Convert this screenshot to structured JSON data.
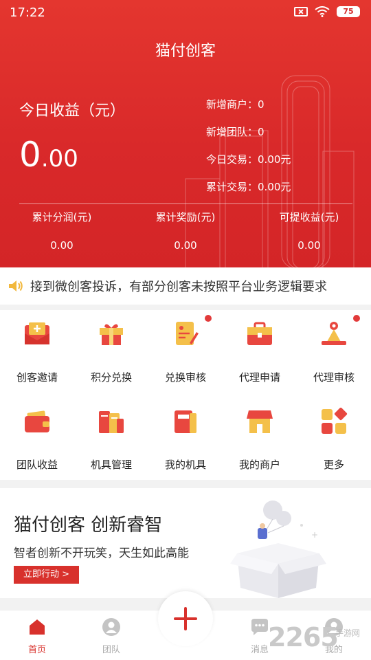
{
  "status_bar": {
    "time": "17:22",
    "battery": "75"
  },
  "header": {
    "title": "猫付创客",
    "earnings_label": "今日收益（元）",
    "earnings_int": "0",
    "earnings_dec": ".00",
    "stats": [
      {
        "label": "新增商户：",
        "value": "0"
      },
      {
        "label": "新增团队：",
        "value": "0"
      },
      {
        "label": "今日交易：",
        "value": "0.00元"
      },
      {
        "label": "累计交易：",
        "value": "0.00元"
      }
    ],
    "totals": [
      {
        "label": "累计分润(元)",
        "value": "0.00"
      },
      {
        "label": "累计奖励(元)",
        "value": "0.00"
      },
      {
        "label": "可提收益(元)",
        "value": "0.00"
      }
    ]
  },
  "notice": {
    "text": "接到微创客投诉，有部分创客未按照平台业务逻辑要求"
  },
  "menu": {
    "items": [
      {
        "label": "创客邀请",
        "icon": "invite-icon"
      },
      {
        "label": "积分兑换",
        "icon": "gift-icon"
      },
      {
        "label": "兑换审核",
        "icon": "review-doc-icon"
      },
      {
        "label": "代理申请",
        "icon": "briefcase-icon"
      },
      {
        "label": "代理审核",
        "icon": "agent-review-icon"
      },
      {
        "label": "团队收益",
        "icon": "wallet-icon"
      },
      {
        "label": "机具管理",
        "icon": "devices-icon"
      },
      {
        "label": "我的机具",
        "icon": "my-device-icon"
      },
      {
        "label": "我的商户",
        "icon": "store-icon"
      },
      {
        "label": "更多",
        "icon": "more-grid-icon"
      }
    ]
  },
  "banner": {
    "title": "猫付创客 创新睿智",
    "subtitle": "智者创新不开玩笑，天生如此高能",
    "button": "立即行动 >"
  },
  "bottom_nav": {
    "items": [
      {
        "label": "首页",
        "icon": "home-icon"
      },
      {
        "label": "团队",
        "icon": "team-icon"
      },
      {
        "label": "消息",
        "icon": "message-icon"
      },
      {
        "label": "我的",
        "icon": "profile-icon"
      }
    ]
  },
  "watermark": {
    "text": "2265",
    "sub": "手游网"
  },
  "colors": {
    "brand_red": "#d8312c",
    "icon_yellow": "#f4c04a",
    "icon_red": "#e8473f"
  }
}
